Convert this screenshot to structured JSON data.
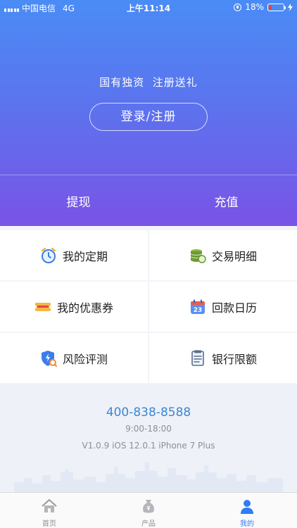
{
  "status_bar": {
    "carrier": "中国电信",
    "network": "4G",
    "time": "上午11:14",
    "battery": "18%",
    "battery_level": 0.18
  },
  "hero": {
    "slogan": "国有独资  注册送礼",
    "login_label": "登录/注册",
    "withdraw_label": "提现",
    "recharge_label": "充值"
  },
  "menu": [
    {
      "label": "我的定期",
      "icon": "alarm-clock-icon"
    },
    {
      "label": "交易明细",
      "icon": "coins-icon"
    },
    {
      "label": "我的优惠券",
      "icon": "coupon-icon"
    },
    {
      "label": "回款日历",
      "icon": "calendar-icon"
    },
    {
      "label": "风险评测",
      "icon": "shield-icon"
    },
    {
      "label": "银行限额",
      "icon": "document-icon"
    }
  ],
  "calendar_day": "23",
  "footer": {
    "phone": "400-838-8588",
    "hours": "9:00-18:00",
    "version": "V1.0.9 iOS 12.0.1 iPhone 7 Plus"
  },
  "tabs": [
    {
      "label": "首页",
      "icon": "home-icon",
      "active": false
    },
    {
      "label": "产品",
      "icon": "money-bag-icon",
      "active": false
    },
    {
      "label": "我的",
      "icon": "user-icon",
      "active": true
    }
  ],
  "colors": {
    "accent": "#2f7cf6",
    "gradient_top": "#4a8cf6",
    "gradient_bottom": "#7a53e6",
    "phone": "#3b86d6"
  }
}
